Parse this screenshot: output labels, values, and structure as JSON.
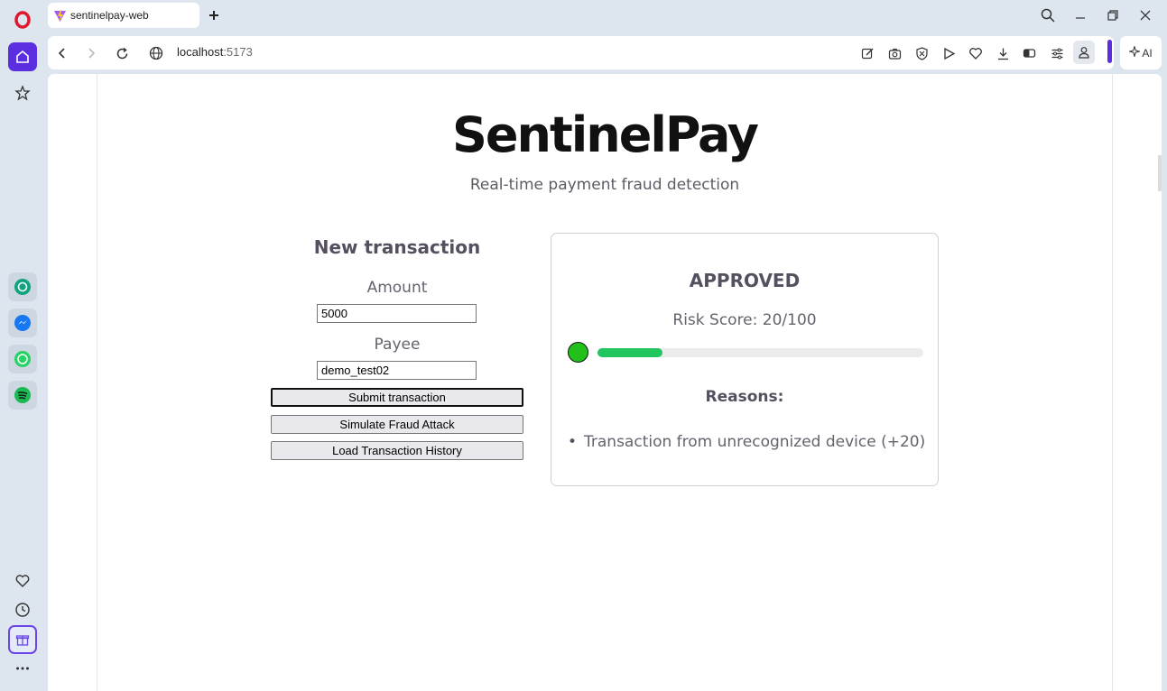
{
  "browser": {
    "tab_title": "sentinelpay-web",
    "url_host": "localhost",
    "url_port": ":5173",
    "ai_label": "AI"
  },
  "sidebar": {
    "items": [
      "opera-logo",
      "home",
      "bookmarks",
      "chatgpt",
      "messenger",
      "whatsapp",
      "spotify",
      "favorites",
      "history",
      "gift",
      "more"
    ]
  },
  "app": {
    "title": "SentinelPay",
    "subtitle": "Real-time payment fraud detection"
  },
  "form": {
    "title": "New transaction",
    "amount_label": "Amount",
    "amount_value": "5000",
    "payee_label": "Payee",
    "payee_value": "demo_test02",
    "submit_label": "Submit transaction",
    "simulate_label": "Simulate Fraud Attack",
    "history_label": "Load Transaction History"
  },
  "result": {
    "status": "APPROVED",
    "risk_text": "Risk Score: 20/100",
    "risk_score": 20,
    "risk_max": 100,
    "status_color": "#22c01a",
    "bar_color": "#22c55e",
    "reasons_title": "Reasons:",
    "reasons": [
      "Transaction from unrecognized device (+20)"
    ]
  }
}
